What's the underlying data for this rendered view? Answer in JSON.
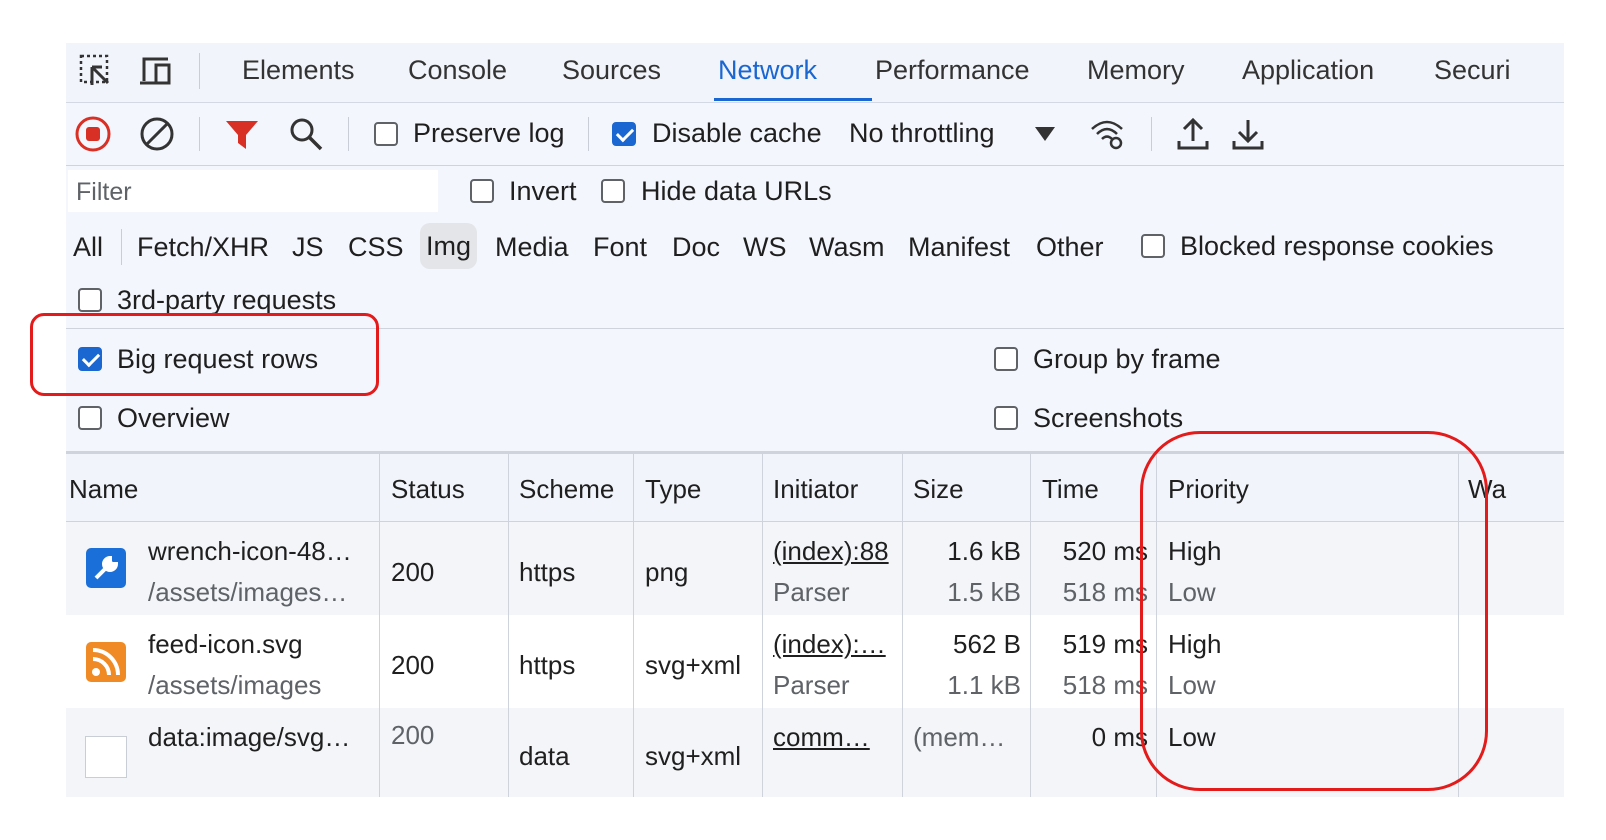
{
  "tabs": [
    {
      "label": "Elements"
    },
    {
      "label": "Console"
    },
    {
      "label": "Sources"
    },
    {
      "label": "Network"
    },
    {
      "label": "Performance"
    },
    {
      "label": "Memory"
    },
    {
      "label": "Application"
    },
    {
      "label": "Securi"
    }
  ],
  "toolbar": {
    "preserve_log": "Preserve log",
    "disable_cache": "Disable cache",
    "throttling": "No throttling"
  },
  "filter": {
    "placeholder": "Filter",
    "invert": "Invert",
    "hide_data_urls": "Hide data URLs",
    "types": [
      "All",
      "Fetch/XHR",
      "JS",
      "CSS",
      "Img",
      "Media",
      "Font",
      "Doc",
      "WS",
      "Wasm",
      "Manifest",
      "Other"
    ],
    "blocked_cookies": "Blocked response cookies",
    "third_party": "3rd-party requests"
  },
  "settings": {
    "big_rows": "Big request rows",
    "group_by_frame": "Group by frame",
    "overview": "Overview",
    "screenshots": "Screenshots"
  },
  "columns": [
    "Name",
    "Status",
    "Scheme",
    "Type",
    "Initiator",
    "Size",
    "Time",
    "Priority",
    "Wa"
  ],
  "rows": [
    {
      "name": "wrench-icon-48…",
      "path": "/assets/images…",
      "status": "200",
      "scheme": "https",
      "type": "png",
      "initiator": "(index):88",
      "initiator_sub": "Parser",
      "size": "1.6 kB",
      "size_sub": "1.5 kB",
      "time": "520 ms",
      "time_sub": "518 ms",
      "priority": "High",
      "priority_sub": "Low"
    },
    {
      "name": "feed-icon.svg",
      "path": "/assets/images",
      "status": "200",
      "scheme": "https",
      "type": "svg+xml",
      "initiator": "(index):…",
      "initiator_sub": "Parser",
      "size": "562 B",
      "size_sub": "1.1 kB",
      "time": "519 ms",
      "time_sub": "518 ms",
      "priority": "High",
      "priority_sub": "Low"
    },
    {
      "name": "data:image/svg…",
      "status": "200",
      "scheme": "data",
      "type": "svg+xml",
      "initiator": "comm…",
      "size": "(mem…",
      "time": "0 ms",
      "priority": "Low"
    }
  ],
  "colors": {
    "accent": "#1a67d2",
    "annotation": "#e31b1b",
    "record": "#d93025"
  }
}
